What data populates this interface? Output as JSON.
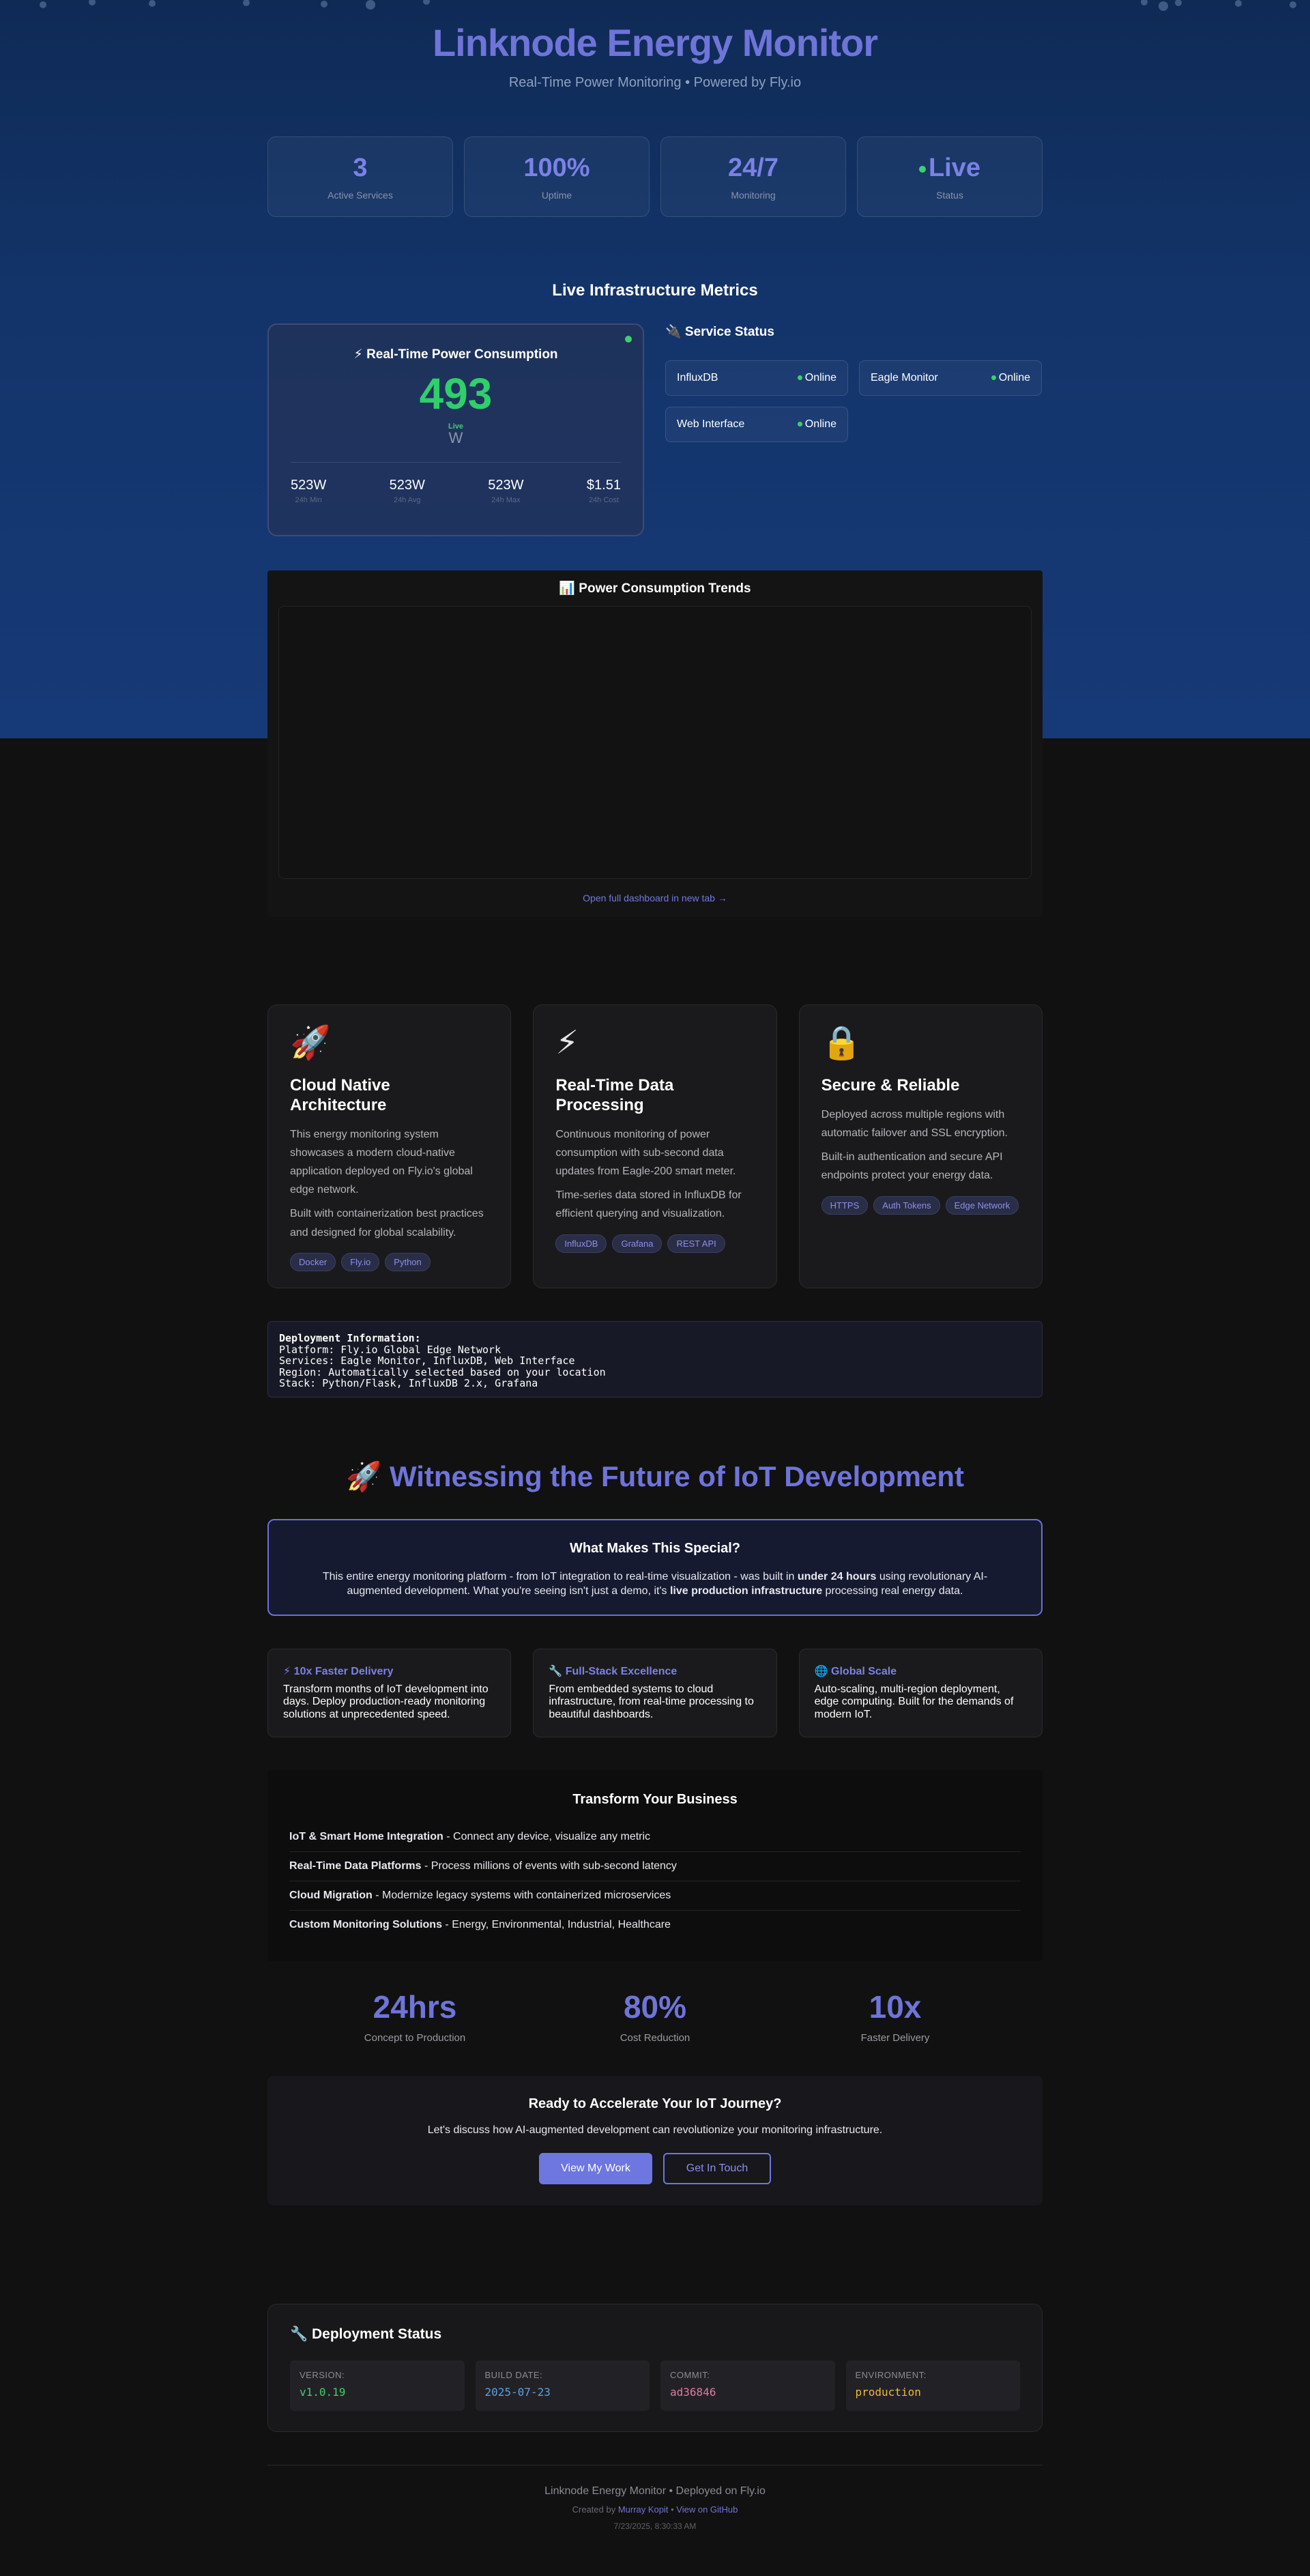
{
  "header": {
    "title": "Linknode Energy Monitor",
    "subtitle": "Real-Time Power Monitoring • Powered by Fly.io"
  },
  "stats": [
    {
      "value": "3",
      "label": "Active Services"
    },
    {
      "value": "100%",
      "label": "Uptime"
    },
    {
      "value": "24/7",
      "label": "Monitoring"
    },
    {
      "value": "Live",
      "label": "Status"
    }
  ],
  "infra": {
    "title": "Live Infrastructure Metrics"
  },
  "power": {
    "title": "⚡ Real-Time Power Consumption",
    "value": "493",
    "live": "Live",
    "unit": "W",
    "stats": [
      {
        "value": "523W",
        "label": "24h Min"
      },
      {
        "value": "523W",
        "label": "24h Avg"
      },
      {
        "value": "523W",
        "label": "24h Max"
      },
      {
        "value": "$1.51",
        "label": "24h Cost"
      }
    ]
  },
  "services": {
    "title": "🔌 Service Status",
    "items": [
      {
        "name": "InfluxDB",
        "status": "Online"
      },
      {
        "name": "Eagle Monitor",
        "status": "Online"
      },
      {
        "name": "Web Interface",
        "status": "Online"
      }
    ]
  },
  "trends": {
    "title": "📊 Power Consumption Trends",
    "link": "Open full dashboard in new tab →"
  },
  "features": [
    {
      "icon": "🚀",
      "title": "Cloud Native Architecture",
      "p1": "This energy monitoring system showcases a modern cloud-native application deployed on Fly.io's global edge network.",
      "p2": "Built with containerization best practices and designed for global scalability.",
      "tags": [
        "Docker",
        "Fly.io",
        "Python"
      ]
    },
    {
      "icon": "⚡",
      "title": "Real-Time Data Processing",
      "p1": "Continuous monitoring of power consumption with sub-second data updates from Eagle-200 smart meter.",
      "p2": "Time-series data stored in InfluxDB for efficient querying and visualization.",
      "tags": [
        "InfluxDB",
        "Grafana",
        "REST API"
      ]
    },
    {
      "icon": "🔒",
      "title": "Secure & Reliable",
      "p1": "Deployed across multiple regions with automatic failover and SSL encryption.",
      "p2": "Built-in authentication and secure API endpoints protect your energy data.",
      "tags": [
        "HTTPS",
        "Auth Tokens",
        "Edge Network"
      ]
    }
  ],
  "deploy": {
    "heading": "Deployment Information:",
    "lines": [
      "Platform: Fly.io Global Edge Network",
      "Services: Eagle Monitor, InfluxDB, Web Interface",
      "Region: Automatically selected based on your location",
      "Stack: Python/Flask, InfluxDB 2.x, Grafana"
    ]
  },
  "future": {
    "title": "🚀 Witnessing the Future of IoT Development"
  },
  "special": {
    "title": "What Makes This Special?",
    "t1": "This entire energy monitoring platform - from IoT integration to real-time visualization - was built in ",
    "b1": "under 24 hours",
    "t2": " using revolutionary AI-augmented development. What you're seeing isn't just a demo, it's ",
    "b2": "live production infrastructure",
    "t3": " processing real energy data."
  },
  "benefits": [
    {
      "title": "⚡ 10x Faster Delivery",
      "text": "Transform months of IoT development into days. Deploy production-ready monitoring solutions at unprecedented speed."
    },
    {
      "title": "🔧 Full-Stack Excellence",
      "text": "From embedded systems to cloud infrastructure, from real-time processing to beautiful dashboards."
    },
    {
      "title": "🌐 Global Scale",
      "text": "Auto-scaling, multi-region deployment, edge computing. Built for the demands of modern IoT."
    }
  ],
  "transform": {
    "title": "Transform Your Business",
    "items": [
      {
        "bold": "IoT & Smart Home Integration",
        "text": " - Connect any device, visualize any metric"
      },
      {
        "bold": "Real-Time Data Platforms",
        "text": " - Process millions of events with sub-second latency"
      },
      {
        "bold": "Cloud Migration",
        "text": " - Modernize legacy systems with containerized microservices"
      },
      {
        "bold": "Custom Monitoring Solutions",
        "text": " - Energy, Environmental, Industrial, Healthcare"
      }
    ]
  },
  "metrics": [
    {
      "value": "24hrs",
      "label": "Concept to Production"
    },
    {
      "value": "80%",
      "label": "Cost Reduction"
    },
    {
      "value": "10x",
      "label": "Faster Delivery"
    }
  ],
  "cta": {
    "title": "Ready to Accelerate Your IoT Journey?",
    "text": "Let's discuss how AI-augmented development can revolutionize your monitoring infrastructure.",
    "primary": "View My Work",
    "secondary": "Get In Touch"
  },
  "status": {
    "title": "🔧 Deployment Status",
    "items": [
      {
        "label": "VERSION:",
        "value": "v1.0.19",
        "color": "#3ecf6e"
      },
      {
        "label": "BUILD DATE:",
        "value": "2025-07-23",
        "color": "#5aa0e6"
      },
      {
        "label": "COMMIT:",
        "value": "ad36846",
        "color": "#e07aa0"
      },
      {
        "label": "ENVIRONMENT:",
        "value": "production",
        "color": "#f0b73a"
      }
    ]
  },
  "footer": {
    "line1": "Linknode Energy Monitor • Deployed on Fly.io",
    "created": "Created by ",
    "author": "Murray Kopit",
    "sep": " • ",
    "github": "View on GitHub",
    "timestamp": "7/23/2025, 8:30:33 AM"
  },
  "colors": {
    "accent": "#6f74d9",
    "green": "#3ecf6e",
    "hero": "#13346a",
    "background": "#111111"
  }
}
